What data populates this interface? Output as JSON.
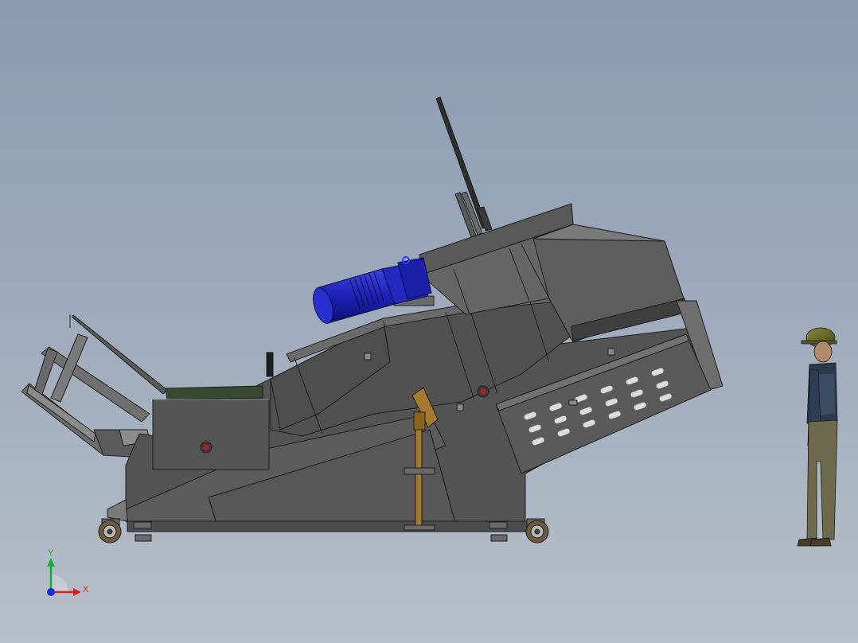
{
  "colors": {
    "background_top": "#8a9bb2",
    "background_bottom": "#b8bfc9",
    "machine_body": "#525252",
    "machine_light": "#6a6a6a",
    "machine_dark": "#3c3c3c",
    "motor_blue": "#1c22b5",
    "stand_amber": "#a47a2e",
    "axis_x": "#e0201c",
    "axis_y": "#1aa83a",
    "axis_z": "#1c2fd6"
  },
  "triad": {
    "x_label": "X",
    "y_label": "Y"
  },
  "objects": {
    "machine": "machine-assembly",
    "motor": "drive-motor",
    "figure": "human-figure"
  }
}
